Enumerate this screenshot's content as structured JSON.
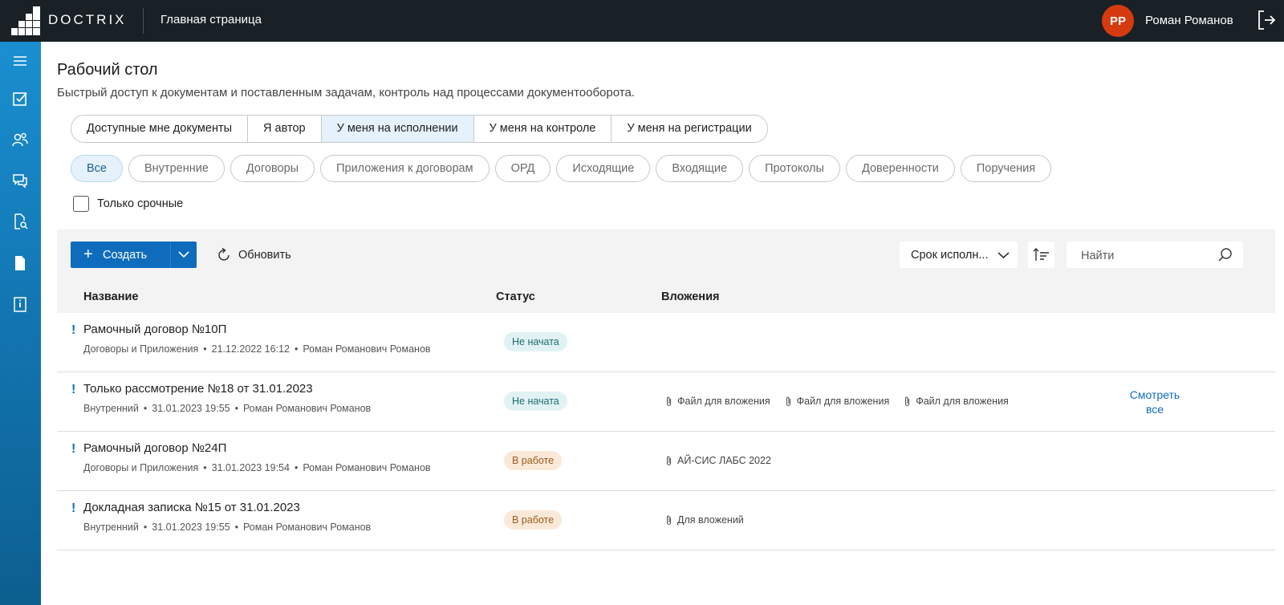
{
  "header": {
    "logo_text": "DOCTRIX",
    "title": "Главная страница",
    "user_initials": "РР",
    "user_name": "Роман Романов"
  },
  "sidebar": {
    "icons": [
      "menu-icon",
      "tasks-icon",
      "contacts-icon",
      "chat-icon",
      "document-search-icon",
      "document-icon",
      "info-book-icon"
    ]
  },
  "page": {
    "title": "Рабочий стол",
    "subtitle": "Быстрый доступ к документам и поставленным задачам, контроль над процессами документооборота."
  },
  "tabs": [
    {
      "label": "Доступные мне документы",
      "active": false
    },
    {
      "label": "Я автор",
      "active": false
    },
    {
      "label": "У меня на исполнении",
      "active": true
    },
    {
      "label": "У меня на контроле",
      "active": false
    },
    {
      "label": "У меня на регистрации",
      "active": false
    }
  ],
  "filters": [
    {
      "label": "Все",
      "active": true
    },
    {
      "label": "Внутренние",
      "active": false
    },
    {
      "label": "Договоры",
      "active": false
    },
    {
      "label": "Приложения к договорам",
      "active": false
    },
    {
      "label": "ОРД",
      "active": false
    },
    {
      "label": "Исходящие",
      "active": false
    },
    {
      "label": "Входящие",
      "active": false
    },
    {
      "label": "Протоколы",
      "active": false
    },
    {
      "label": "Доверенности",
      "active": false
    },
    {
      "label": "Поручения",
      "active": false
    }
  ],
  "urgent_only": {
    "label": "Только срочные",
    "checked": false
  },
  "toolbar": {
    "create_label": "Создать",
    "refresh_label": "Обновить",
    "sort_label": "Срок исполн...",
    "search_placeholder": "Найти"
  },
  "table": {
    "columns": {
      "name": "Название",
      "status": "Статус",
      "attachments": "Вложения"
    },
    "rows": [
      {
        "mark": "!",
        "title": "Рамочный договор №10П",
        "type": "Договоры и Приложения",
        "date": "21.12.2022 16:12",
        "author": "Роман Романович Романов",
        "status": "Не начата",
        "status_kind": "notstarted",
        "attachments": [],
        "see_all": ""
      },
      {
        "mark": "!",
        "title": "Только рассмотрение №18 от 31.01.2023",
        "type": "Внутренний",
        "date": "31.01.2023 19:55",
        "author": "Роман Романович Романов",
        "status": "Не начата",
        "status_kind": "notstarted",
        "attachments": [
          "Файл для вложения",
          "Файл для вложения",
          "Файл для вложения"
        ],
        "see_all": "Смотреть все"
      },
      {
        "mark": "!",
        "title": "Рамочный договор №24П",
        "type": "Договоры и Приложения",
        "date": "31.01.2023 19:54",
        "author": "Роман Романович Романов",
        "status": "В работе",
        "status_kind": "inwork",
        "attachments": [
          "АЙ-СИС ЛАБС 2022"
        ],
        "see_all": ""
      },
      {
        "mark": "!",
        "title": "Докладная записка №15 от 31.01.2023",
        "type": "Внутренний",
        "date": "31.01.2023 19:55",
        "author": "Роман Романович Романов",
        "status": "В работе",
        "status_kind": "inwork",
        "attachments": [
          "Для вложений"
        ],
        "see_all": ""
      }
    ]
  },
  "colors": {
    "topbar": "#192026",
    "accent": "#0f6cbd",
    "avatar": "#d63b10",
    "sidebar_top": "#1a8fd0",
    "sidebar_bottom": "#0c5f8f",
    "badge_notstarted": "#e1f2f4",
    "badge_inwork": "#fbe9d8"
  }
}
